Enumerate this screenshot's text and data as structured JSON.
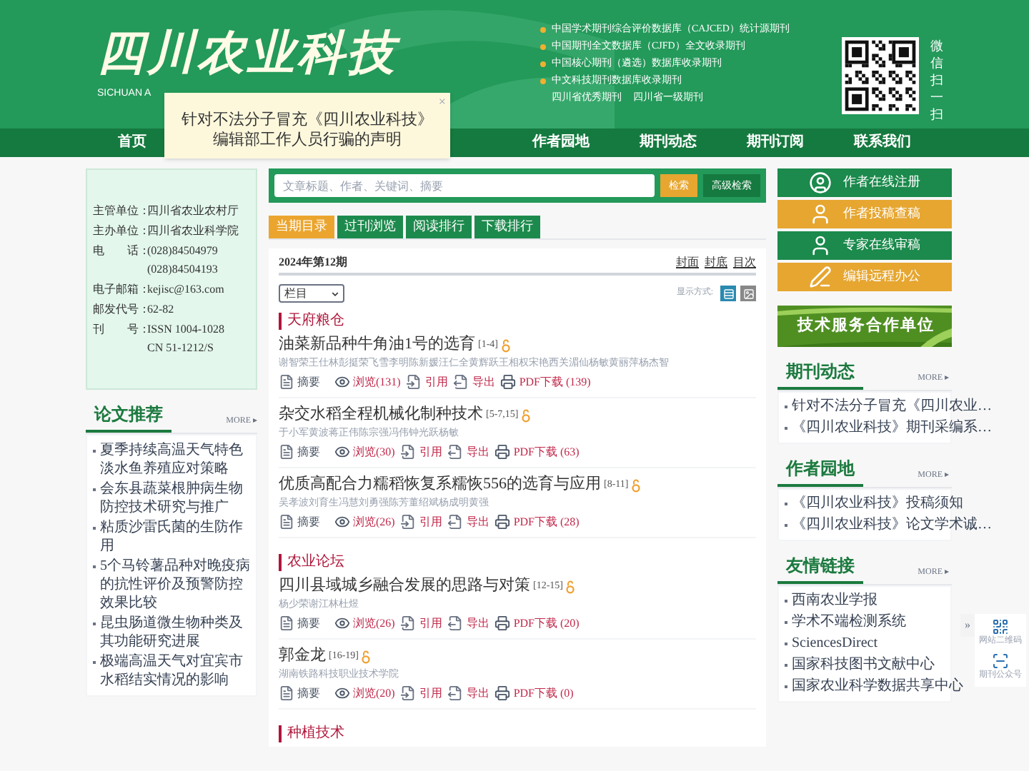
{
  "header": {
    "logo": "四川农业科技",
    "subtitle": "SICHUAN A",
    "indexing": [
      "中国学术期刊综合评价数据库（CAJCED）统计源期刊",
      "中国期刊全文数据库（CJFD）全文收录期刊",
      "中国核心期刊（遴选）数据库收录期刊",
      "中文科技期刊数据库收录期刊"
    ],
    "honors": [
      "四川省优秀期刊",
      "四川省一级期刊"
    ],
    "qr_caption": "微信扫一扫"
  },
  "notice": {
    "text": "针对不法分子冒充《四川农业科技》编辑部工作人员行骗的声明",
    "close": "×"
  },
  "nav": [
    {
      "label": "首页",
      "selected": false
    },
    {
      "label": "作者园地",
      "selected": false
    },
    {
      "label": "期刊动态",
      "selected": false
    },
    {
      "label": "期刊订阅",
      "selected": false
    },
    {
      "label": "联系我们",
      "selected": false
    }
  ],
  "info": [
    {
      "label": "主管单位：",
      "values": [
        "四川省农业农村厅"
      ]
    },
    {
      "label": "主办单位：",
      "values": [
        "四川省农业科学院"
      ]
    },
    {
      "label": "电　　话：",
      "values": [
        "(028)84504979",
        "(028)84504193"
      ]
    },
    {
      "label": "电子邮箱：",
      "values": [
        "kejisc@163.com"
      ]
    },
    {
      "label": "邮发代号：",
      "values": [
        "62-82"
      ]
    },
    {
      "label": "刊　　号：",
      "values": [
        "ISSN 1004-1028",
        "CN 51-1212/S"
      ]
    }
  ],
  "recommend": {
    "title": "论文推荐",
    "more": "MORE ▸",
    "items": [
      "夏季持续高温天气特色淡水鱼养殖应对策略",
      "会东县蔬菜根肿病生物防控技术研究与推广",
      "粘质沙雷氏菌的生防作用",
      "5个马铃薯品种对晚疫病的抗性评价及预警防控效果比较",
      "昆虫肠道微生物种类及其功能研究进展",
      "极端高温天气对宜宾市水稻结实情况的影响"
    ]
  },
  "search": {
    "placeholder": "文章标题、作者、关键词、摘要",
    "buttons": [
      "检索",
      "高级检索"
    ]
  },
  "tabs": [
    {
      "label": "当期目录",
      "selected": true
    },
    {
      "label": "过刊浏览",
      "selected": false
    },
    {
      "label": "阅读排行",
      "selected": false
    },
    {
      "label": "下载排行",
      "selected": false
    }
  ],
  "issue": {
    "title": "2024年第12期",
    "links": [
      "封面",
      "封底",
      "目次"
    ],
    "column_select": "栏目",
    "view_label": "显示方式:",
    "views": [
      {
        "kind": "list",
        "selected": true
      },
      {
        "kind": "grid",
        "selected": false
      }
    ]
  },
  "sections": [
    {
      "title": "天府粮仓",
      "articles": [
        {
          "title": "油菜新品种牛角油1号的选育",
          "pages": "[1-4]",
          "byline": "谢智荣王仕林彭挺荣飞雪李明陈新媛汪仁全黄辉跃王相权宋艳西关湄仙杨敏黄丽萍杨杰智",
          "actions": [
            {
              "kind": "abstract",
              "label": "摘要"
            },
            {
              "kind": "view",
              "label": "浏览(131)"
            },
            {
              "kind": "cite",
              "label": "引用"
            },
            {
              "kind": "export",
              "label": "导出"
            },
            {
              "kind": "pdf",
              "label": "PDF下载 (139)"
            }
          ]
        },
        {
          "title": "杂交水稻全程机械化制种技术",
          "pages": "[5-7,15]",
          "byline": "于小军黄波蒋正伟陈宗强冯伟钟光跃杨敏",
          "actions": [
            {
              "kind": "abstract",
              "label": "摘要"
            },
            {
              "kind": "view",
              "label": "浏览(30)"
            },
            {
              "kind": "cite",
              "label": "引用"
            },
            {
              "kind": "export",
              "label": "导出"
            },
            {
              "kind": "pdf",
              "label": "PDF下载 (63)"
            }
          ]
        },
        {
          "title": "优质高配合力糯稻恢复系糯恢556的选育与应用",
          "pages": "[8-11]",
          "byline": "吴孝波刘育生冯慧刘勇强陈芳董绍斌杨成明黄强",
          "actions": [
            {
              "kind": "abstract",
              "label": "摘要"
            },
            {
              "kind": "view",
              "label": "浏览(26)"
            },
            {
              "kind": "cite",
              "label": "引用"
            },
            {
              "kind": "export",
              "label": "导出"
            },
            {
              "kind": "pdf",
              "label": "PDF下载 (28)"
            }
          ]
        }
      ]
    },
    {
      "title": "农业论坛",
      "articles": [
        {
          "title": "四川县域城乡融合发展的思路与对策",
          "pages": "[12-15]",
          "byline": "杨少荣谢江林杜煜",
          "actions": [
            {
              "kind": "abstract",
              "label": "摘要"
            },
            {
              "kind": "view",
              "label": "浏览(26)"
            },
            {
              "kind": "cite",
              "label": "引用"
            },
            {
              "kind": "export",
              "label": "导出"
            },
            {
              "kind": "pdf",
              "label": "PDF下载 (20)"
            }
          ]
        },
        {
          "title": "郭金龙",
          "pages": "[16-19]",
          "byline": "湖南铁路科技职业技术学院",
          "actions": [
            {
              "kind": "abstract",
              "label": "摘要"
            },
            {
              "kind": "view",
              "label": "浏览(20)"
            },
            {
              "kind": "cite",
              "label": "引用"
            },
            {
              "kind": "export",
              "label": "导出"
            },
            {
              "kind": "pdf",
              "label": "PDF下载 (0)"
            }
          ]
        }
      ]
    },
    {
      "title": "种植技术"
    }
  ],
  "services": [
    {
      "kind": "register",
      "label": "作者在线注册",
      "color": "#1b8a4c"
    },
    {
      "kind": "submit",
      "label": "作者投稿查稿",
      "color": "#e6a630"
    },
    {
      "kind": "review",
      "label": "专家在线审稿",
      "color": "#1b8a4c"
    },
    {
      "kind": "office",
      "label": "编辑远程办公",
      "color": "#e6a630"
    }
  ],
  "banner": {
    "kind": "picture",
    "text": "技术服务合作单位"
  },
  "side_lists": [
    {
      "title": "期刊动态",
      "more": "MORE ▸",
      "items": [
        "针对不法分子冒充《四川农业…",
        "《四川农业科技》期刊采编系…"
      ]
    },
    {
      "title": "作者园地",
      "more": "MORE ▸",
      "items": [
        "《四川农业科技》投稿须知",
        "《四川农业科技》论文学术诚…"
      ]
    },
    {
      "title": "友情链接",
      "more": "MORE ▸",
      "items": [
        "西南农业学报",
        "学术不端检测系统",
        "SciencesDirect",
        "国家科技图书文献中心",
        "国家农业科学数据共享中心"
      ]
    }
  ],
  "float_panel": {
    "toggle": "»",
    "items": [
      {
        "kind": "qr",
        "label": "网站二维码"
      },
      {
        "kind": "scan",
        "label": "期刊公众号"
      }
    ]
  }
}
